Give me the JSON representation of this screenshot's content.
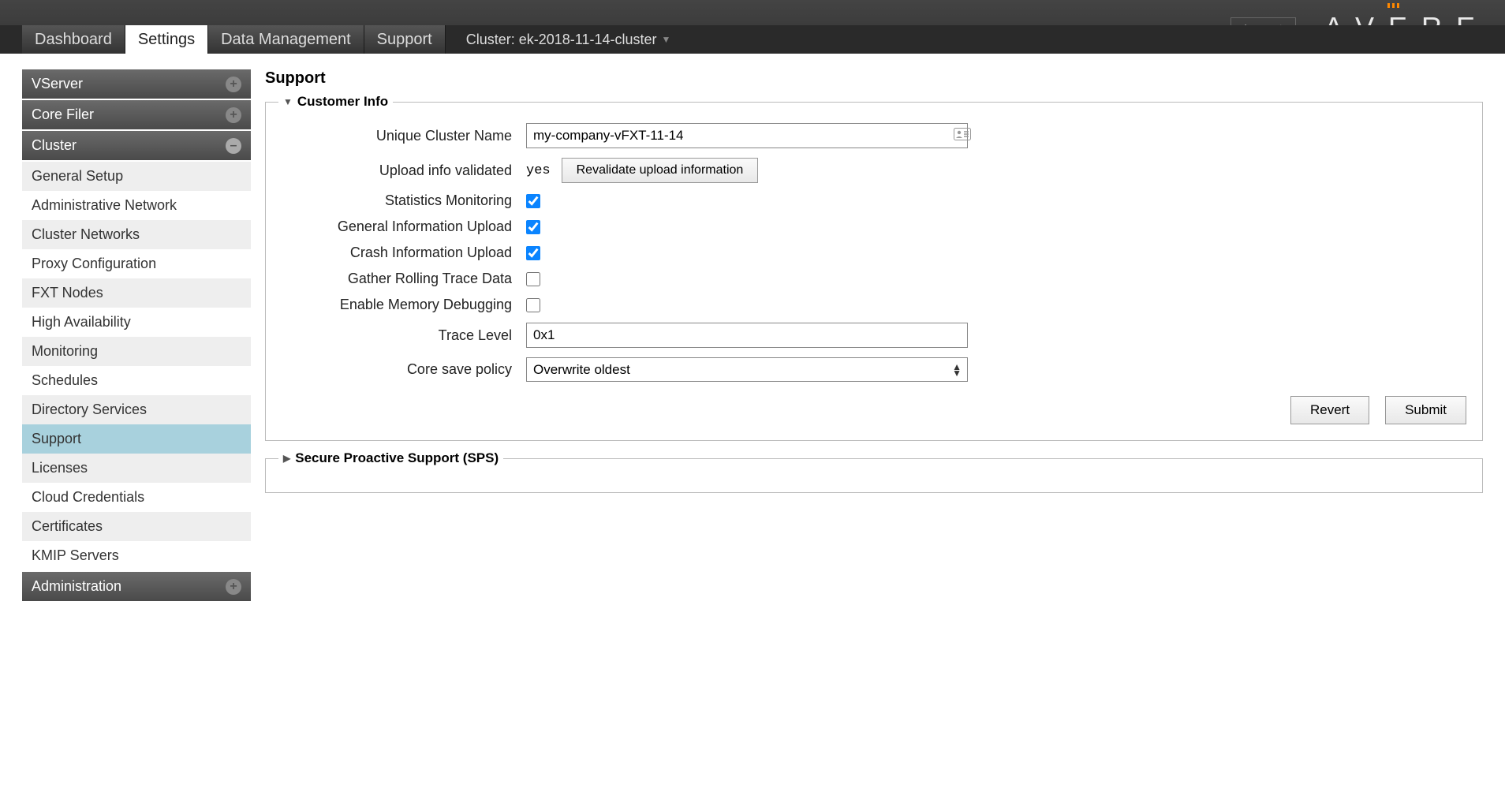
{
  "header": {
    "logout": "Logout",
    "logo_letters": [
      "A",
      "V",
      "E",
      "R",
      "E"
    ],
    "cluster_prefix": "Cluster:",
    "cluster_name": "ek-2018-11-14-cluster"
  },
  "tabs": {
    "dashboard": "Dashboard",
    "settings": "Settings",
    "data_mgmt": "Data Management",
    "support": "Support"
  },
  "sidebar": {
    "vserver": {
      "label": "VServer"
    },
    "core_filer": {
      "label": "Core Filer"
    },
    "cluster": {
      "label": "Cluster",
      "items": [
        "General Setup",
        "Administrative Network",
        "Cluster Networks",
        "Proxy Configuration",
        "FXT Nodes",
        "High Availability",
        "Monitoring",
        "Schedules",
        "Directory Services",
        "Support",
        "Licenses",
        "Cloud Credentials",
        "Certificates",
        "KMIP Servers"
      ],
      "selected_index": 9
    },
    "administration": {
      "label": "Administration"
    }
  },
  "main": {
    "title": "Support",
    "customer_info": {
      "legend": "Customer Info",
      "labels": {
        "unique_cluster_name": "Unique Cluster Name",
        "upload_validated": "Upload info validated",
        "stats_monitoring": "Statistics Monitoring",
        "general_upload": "General Information Upload",
        "crash_upload": "Crash Information Upload",
        "rolling_trace": "Gather Rolling Trace Data",
        "mem_debug": "Enable Memory Debugging",
        "trace_level": "Trace Level",
        "core_save": "Core save policy"
      },
      "values": {
        "unique_cluster_name": "my-company-vFXT-11-14",
        "upload_validated": "yes",
        "revalidate_btn": "Revalidate upload information",
        "stats_monitoring": true,
        "general_upload": true,
        "crash_upload": true,
        "rolling_trace": false,
        "mem_debug": false,
        "trace_level": "0x1",
        "core_save": "Overwrite oldest"
      },
      "actions": {
        "revert": "Revert",
        "submit": "Submit"
      }
    },
    "sps": {
      "legend": "Secure Proactive Support (SPS)"
    }
  }
}
